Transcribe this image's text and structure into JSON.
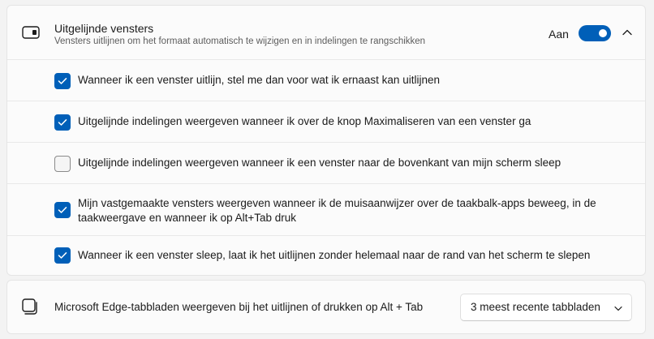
{
  "snap": {
    "title": "Uitgelijnde vensters",
    "description": "Vensters uitlijnen om het formaat automatisch te wijzigen en in indelingen te rangschikken",
    "toggle_label": "Aan",
    "toggle_on": true,
    "options": [
      {
        "label": "Wanneer ik een venster uitlijn, stel me dan voor wat ik ernaast kan uitlijnen",
        "checked": true
      },
      {
        "label": "Uitgelijnde indelingen weergeven wanneer ik over de knop Maximaliseren van een venster ga",
        "checked": true
      },
      {
        "label": "Uitgelijnde indelingen weergeven wanneer ik een venster naar de bovenkant van mijn scherm sleep",
        "checked": false
      },
      {
        "label": "Mijn vastgemaakte vensters weergeven wanneer ik de muisaanwijzer over de taakbalk-apps beweeg, in de taakweergave en wanneer ik op Alt+Tab druk",
        "checked": true
      },
      {
        "label": "Wanneer ik een venster sleep, laat ik het uitlijnen zonder helemaal naar de rand van het scherm te slepen",
        "checked": true
      }
    ]
  },
  "edge": {
    "label": "Microsoft Edge-tabbladen weergeven bij het uitlijnen of drukken op Alt + Tab",
    "dropdown_value": "3 meest recente tabbladen"
  },
  "icons": {
    "snap": "snap-layout-icon",
    "edge": "stacked-windows-icon",
    "expand": "chevron-up-icon",
    "dropdown": "chevron-down-icon",
    "check": "checkmark-icon"
  },
  "colors": {
    "accent": "#005fb8",
    "background": "#f3f3f3",
    "card": "#fbfbfb"
  }
}
